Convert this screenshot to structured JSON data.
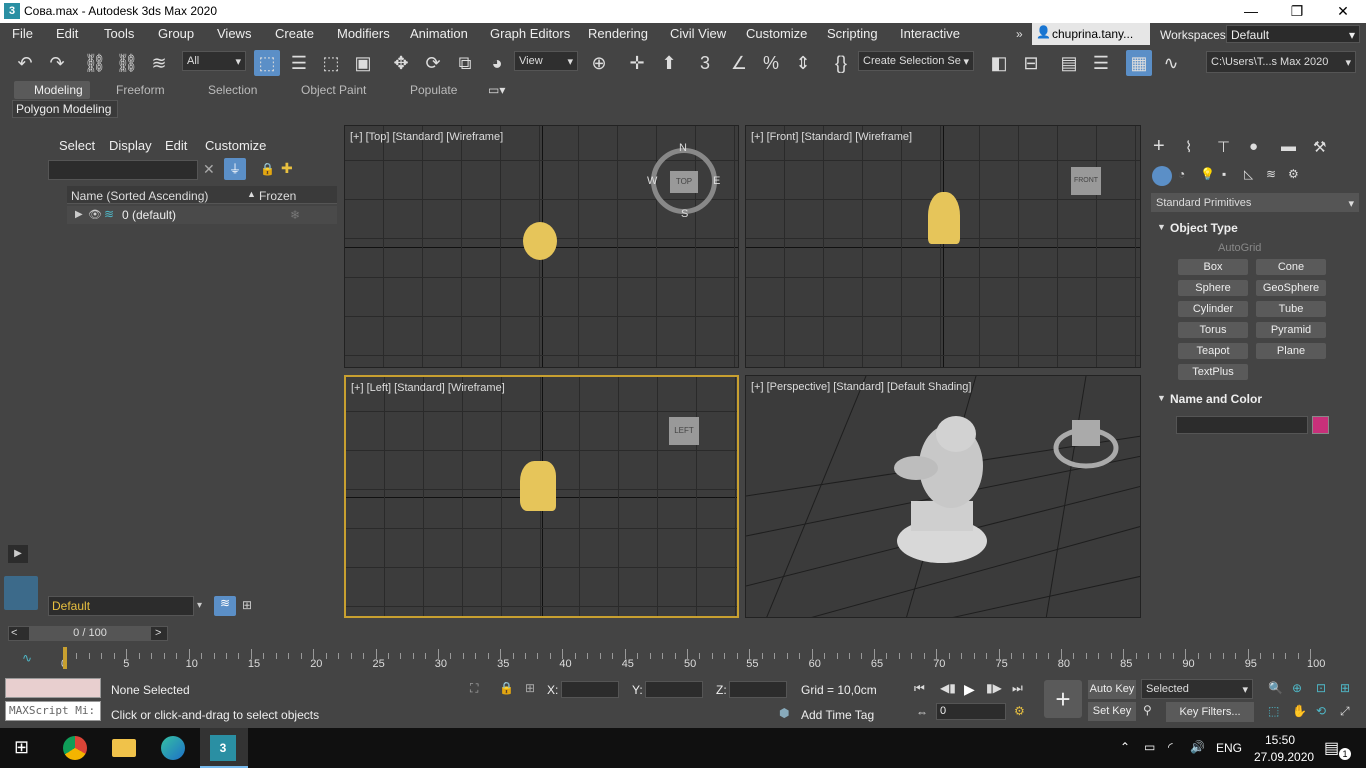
{
  "window": {
    "title": "Сова.max - Autodesk 3ds Max 2020",
    "logo": "3",
    "minimize": "—",
    "restore": "❐",
    "close": "✕"
  },
  "menu": [
    "File",
    "Edit",
    "Tools",
    "Group",
    "Views",
    "Create",
    "Modifiers",
    "Animation",
    "Graph Editors",
    "Rendering",
    "Civil View",
    "Customize",
    "Scripting",
    "Interactive"
  ],
  "account": "chuprina.tany...",
  "workspaces": {
    "label": "Workspaces:",
    "value": "Default"
  },
  "toolbar": {
    "filter": "All",
    "view": "View",
    "selection_set": "Create Selection Se",
    "path": "C:\\Users\\T...s Max 2020"
  },
  "ribbon": {
    "tabs": [
      "Modeling",
      "Freeform",
      "Selection",
      "Object Paint",
      "Populate"
    ],
    "sub": "Polygon Modeling"
  },
  "scene_explorer": {
    "tabs": [
      "Select",
      "Display",
      "Edit",
      "Customize"
    ],
    "col_name": "Name (Sorted Ascending)",
    "col_frozen": "Frozen",
    "row": "0 (default)",
    "layer": "Default"
  },
  "viewports": {
    "top": "[+] [Top] [Standard] [Wireframe]",
    "front": "[+] [Front] [Standard] [Wireframe]",
    "left": "[+] [Left] [Standard] [Wireframe]",
    "persp": "[+] [Perspective] [Standard] [Default Shading]",
    "cube_top": "TOP",
    "cube_front": "FRONT",
    "cube_left": "LEFT",
    "compass_n": "N",
    "compass_s": "S",
    "compass_e": "E",
    "compass_w": "W"
  },
  "command_panel": {
    "category": "Standard Primitives",
    "rollout1": "Object Type",
    "autogrid": "AutoGrid",
    "buttons": [
      "Box",
      "Cone",
      "Sphere",
      "GeoSphere",
      "Cylinder",
      "Tube",
      "Torus",
      "Pyramid",
      "Teapot",
      "Plane",
      "TextPlus"
    ],
    "rollout2": "Name and Color",
    "color": "#c8307a"
  },
  "timeline": {
    "frame": "0 / 100",
    "ticks": [
      "0",
      "5",
      "10",
      "15",
      "20",
      "25",
      "30",
      "35",
      "40",
      "45",
      "50",
      "55",
      "60",
      "65",
      "70",
      "75",
      "80",
      "85",
      "90",
      "95",
      "100"
    ]
  },
  "status": {
    "maxscript": "MAXScript Mi:",
    "selection": "None Selected",
    "prompt": "Click or click-and-drag to select objects",
    "x": "X:",
    "y": "Y:",
    "z": "Z:",
    "grid": "Grid = 10,0cm",
    "add_time_tag": "Add Time Tag",
    "auto_key": "Auto Key",
    "set_key": "Set Key",
    "selected": "Selected",
    "key_filters": "Key Filters...",
    "frame_field": "0"
  },
  "taskbar": {
    "lang": "ENG",
    "time": "15:50",
    "date": "27.09.2020",
    "notify": "1"
  }
}
